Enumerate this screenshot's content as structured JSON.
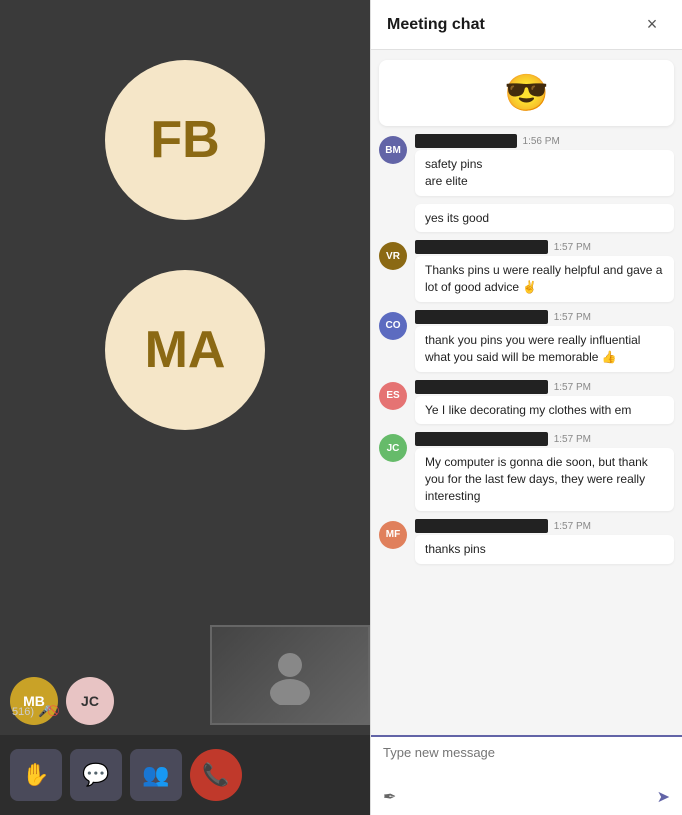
{
  "left_panel": {
    "avatar_fb_initials": "FB",
    "avatar_ma_initials": "MA",
    "controls": [
      {
        "label": "✋",
        "name": "raise-hand",
        "type": "normal"
      },
      {
        "label": "💬",
        "name": "chat",
        "type": "normal"
      },
      {
        "label": "👥",
        "name": "participants",
        "type": "normal"
      },
      {
        "label": "📞",
        "name": "end-call",
        "type": "end"
      }
    ],
    "small_avatars": [
      {
        "initials": "MB",
        "color": "mb"
      },
      {
        "initials": "JC",
        "color": "jc"
      }
    ],
    "mic_label": "516)",
    "mic_muted": true
  },
  "chat": {
    "title": "Meeting chat",
    "close_label": "×",
    "messages": [
      {
        "id": "emoji-msg",
        "type": "emoji",
        "content": "😎"
      },
      {
        "id": "msg-bm",
        "avatar": "BM",
        "avatar_class": "av-bm",
        "name_redacted": "████████████",
        "time": "1:56 PM",
        "lines": [
          "safety pins",
          "are elite"
        ]
      },
      {
        "id": "msg-standalone",
        "type": "standalone",
        "content": "yes its good"
      },
      {
        "id": "msg-vr",
        "avatar": "VR",
        "avatar_class": "av-vr",
        "name_redacted": "████████████████",
        "time": "1:57 PM",
        "lines": [
          "Thanks pins u were really helpful and gave a lot of good advice ✌"
        ]
      },
      {
        "id": "msg-co",
        "avatar": "CO",
        "avatar_class": "av-co",
        "name_redacted": "████████████████",
        "time": "1:57 PM",
        "lines": [
          "thank you pins you were really influential what you said will be memorable 👍"
        ]
      },
      {
        "id": "msg-es",
        "avatar": "ES",
        "avatar_class": "av-es",
        "name_redacted": "████████████████",
        "time": "1:57 PM",
        "lines": [
          "Ye I like decorating my clothes with em"
        ]
      },
      {
        "id": "msg-jc",
        "avatar": "JC",
        "avatar_class": "av-jc",
        "name_redacted": "████████████████",
        "time": "1:57 PM",
        "lines": [
          "My computer is gonna die soon, but thank you for the last few days, they were really interesting"
        ]
      },
      {
        "id": "msg-mf",
        "avatar": "MF",
        "avatar_class": "av-mf",
        "name_redacted": "████████████████",
        "time": "1:57 PM",
        "lines": [
          "thanks pins"
        ]
      }
    ],
    "input_placeholder": "Type new message",
    "input_value": ""
  }
}
